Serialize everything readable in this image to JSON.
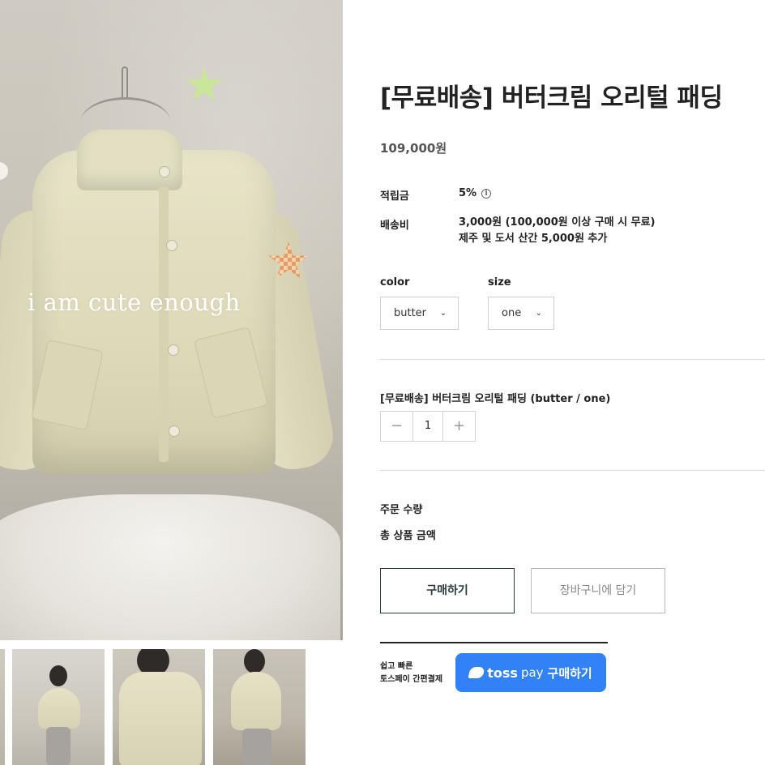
{
  "gallery": {
    "main_caption": "i am cute enough",
    "thumbnail_count": 4
  },
  "product": {
    "title": "[무료배송] 버터크림 오리털 패딩",
    "price": "109,000원"
  },
  "info": {
    "points_label": "적립금",
    "points_value": "5%",
    "points_icon": "info-icon",
    "shipping_label": "배송비",
    "shipping_line1": "3,000원 (100,000원 이상 구매 시 무료)",
    "shipping_line2": "제주 및 도서 산간 5,000원 추가"
  },
  "options": {
    "color_label": "color",
    "color_selected": "butter",
    "size_label": "size",
    "size_selected": "one"
  },
  "selected_item": {
    "name": "[무료배송] 버터크림 오리털 패딩 (butter / one)",
    "quantity": "1",
    "minus": "−",
    "plus": "+"
  },
  "summary": {
    "order_qty_label": "주문 수량",
    "total_label": "총 상품 금액"
  },
  "actions": {
    "buy_label": "구매하기",
    "cart_label": "장바구니에 담기"
  },
  "toss": {
    "caption_line1": "쉽고 빠른",
    "caption_line2": "토스페이 간편결제",
    "brand": "toss",
    "pay": "pay",
    "button_label": "구매하기",
    "color": "#3182f6"
  },
  "colors": {
    "primary_border": "#2c3a3a",
    "divider": "#d9d9d9"
  }
}
